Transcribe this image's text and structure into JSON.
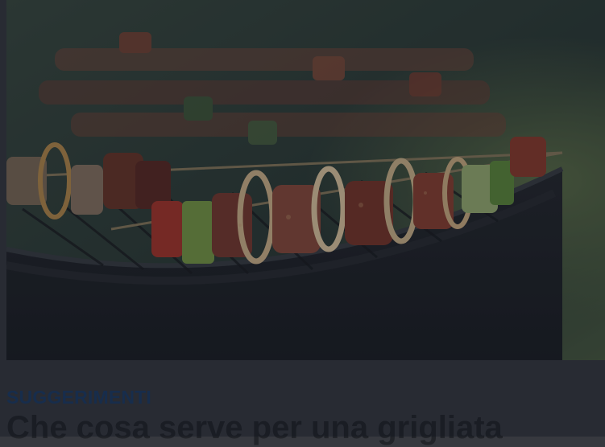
{
  "article": {
    "category": "SUGGERIMENTI",
    "title": "Che cosa serve per una grigliata"
  },
  "colors": {
    "background": "#37393f",
    "category": "#1e3b63",
    "title": "#222429",
    "overlay": "rgba(10,16,28,0.32)"
  },
  "image": {
    "subject": "barbecue-skewers-on-kettle-grill"
  }
}
